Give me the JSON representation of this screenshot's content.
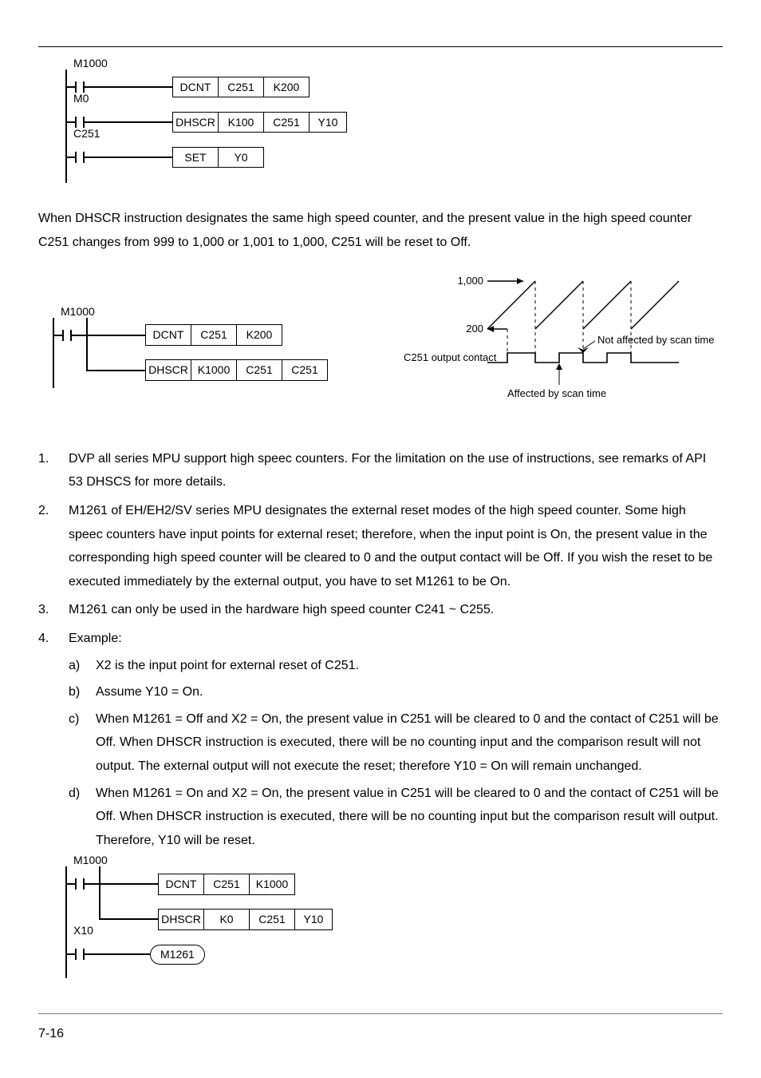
{
  "ladder1": {
    "r1_label": "M1000",
    "r1_cells": [
      "DCNT",
      "C251",
      "K200"
    ],
    "r2_label": "M0",
    "r2_cells": [
      "DHSCR",
      "K100",
      "C251",
      "Y10"
    ],
    "r3_label": "C251",
    "r3_cells": [
      "SET",
      "Y0"
    ]
  },
  "para1": "When DHSCR instruction designates the same high speed counter, and the present value in the high speed counter C251 changes from 999 to 1,000 or 1,001 to 1,000, C251 will be reset to Off.",
  "ladder2": {
    "r1_label": "M1000",
    "r1_cells": [
      "DCNT",
      "C251",
      "K200"
    ],
    "r2_cells": [
      "DHSCR",
      "K1000",
      "C251",
      "C251"
    ]
  },
  "timing": {
    "v1": "1,000",
    "v2": "200",
    "sig": "C251 output contact",
    "note_hi": "Not affected by scan time",
    "note_lo": "Affected by scan time"
  },
  "list": {
    "i1": "DVP all series MPU support high speec counters. For the limitation on the use of instructions, see remarks of API 53 DHSCS for more details.",
    "i2": "M1261 of EH/EH2/SV series MPU designates the external reset modes of the high speed counter. Some high speec counters have input points for external reset; therefore, when the input point is On, the present value in the corresponding high speed counter will be cleared to 0 and the output contact will be Off. If you wish the reset to be executed immediately by the external output, you have to set M1261 to be On.",
    "i3": "M1261 can only be used in the hardware high speed counter C241 ~ C255.",
    "i4": "Example:",
    "a": "X2 is the input point for external reset of C251.",
    "b": "Assume Y10 = On.",
    "c": "When M1261 = Off and X2 = On, the present value in C251 will be cleared to 0 and the contact of C251 will be Off. When DHSCR instruction is executed, there will be no counting input and the comparison result will not output. The external output will not execute the reset; therefore Y10 = On will remain unchanged.",
    "d": "When M1261 = On and X2 = On, the present value in C251 will be cleared to 0 and the contact of C251 will be Off. When DHSCR instruction is executed, there will be no counting input but the comparison result will output. Therefore, Y10 will be reset."
  },
  "ladder3": {
    "r1_label": "M1000",
    "r1_cells": [
      "DCNT",
      "C251",
      "K1000"
    ],
    "r2_cells": [
      "DHSCR",
      "K0",
      "C251",
      "Y10"
    ],
    "r3_label": "X10",
    "r3_coil": "M1261"
  },
  "footer": "7-16"
}
